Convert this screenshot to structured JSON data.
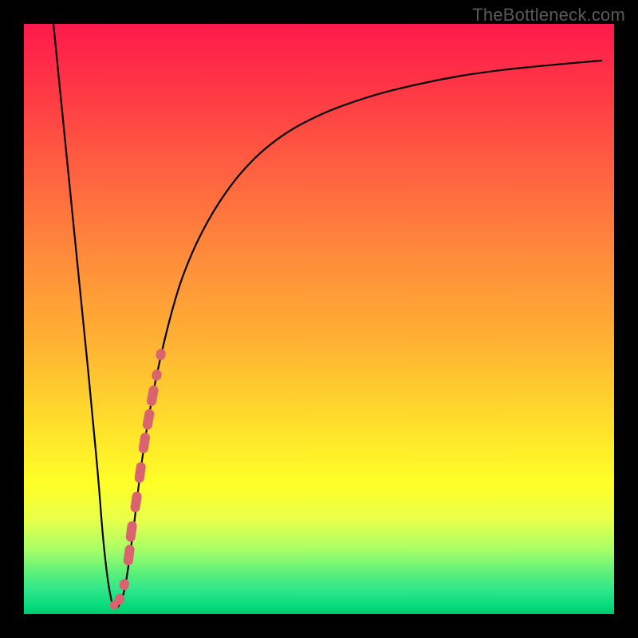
{
  "watermark": "TheBottleneck.com",
  "colors": {
    "frame": "#000000",
    "curve": "#000000",
    "markers": "#d9646e",
    "gradient_top": "#ff1a4b",
    "gradient_bottom": "#00c86c"
  },
  "chart_data": {
    "type": "line",
    "title": "",
    "xlabel": "",
    "ylabel": "",
    "xlim": [
      0,
      100
    ],
    "ylim": [
      0,
      100
    ],
    "grid": false,
    "legend": false,
    "series": [
      {
        "name": "bottleneck-curve",
        "x": [
          5,
          7,
          9,
          11,
          12.5,
          13.5,
          14.5,
          15.5,
          17,
          18.5,
          20,
          22,
          25,
          28,
          32,
          37,
          43,
          50,
          58,
          66,
          74,
          82,
          90,
          98
        ],
        "y": [
          100,
          80,
          60,
          40,
          24,
          12,
          4,
          1,
          4,
          14,
          26,
          38,
          51,
          60,
          68,
          75,
          80.5,
          84.5,
          87.5,
          89.6,
          91.2,
          92.3,
          93.1,
          93.8
        ]
      }
    ],
    "markers": {
      "name": "highlighted-segment",
      "x": [
        16.2,
        17.0,
        17.8,
        18.2,
        19.0,
        19.7,
        20.4,
        21.1,
        21.8,
        22.5,
        23.2
      ],
      "y": [
        2.5,
        5,
        10,
        14,
        19,
        24,
        29,
        33,
        37,
        40.5,
        44
      ]
    }
  }
}
